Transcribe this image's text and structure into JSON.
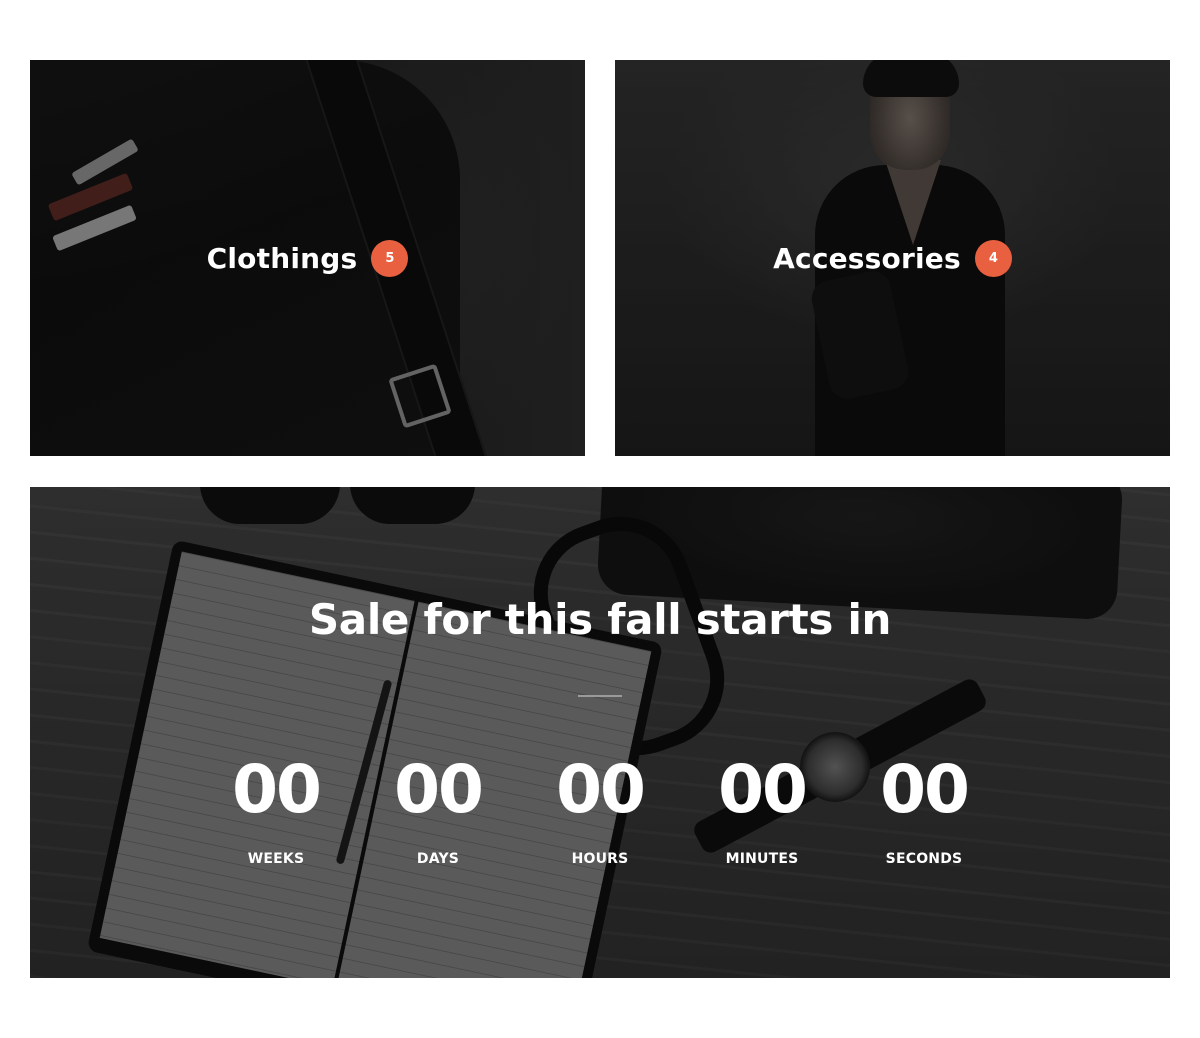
{
  "categories": [
    {
      "name": "Clothings",
      "count": "5"
    },
    {
      "name": "Accessories",
      "count": "4"
    }
  ],
  "sale": {
    "title": "Sale for this fall starts in",
    "countdown": [
      {
        "value": "00",
        "label": "WEEKS"
      },
      {
        "value": "00",
        "label": "DAYS"
      },
      {
        "value": "00",
        "label": "HOURS"
      },
      {
        "value": "00",
        "label": "MINUTES"
      },
      {
        "value": "00",
        "label": "SECONDS"
      }
    ]
  },
  "colors": {
    "badge": "#e8603f",
    "text": "#ffffff",
    "page_background": "#ffffff"
  }
}
